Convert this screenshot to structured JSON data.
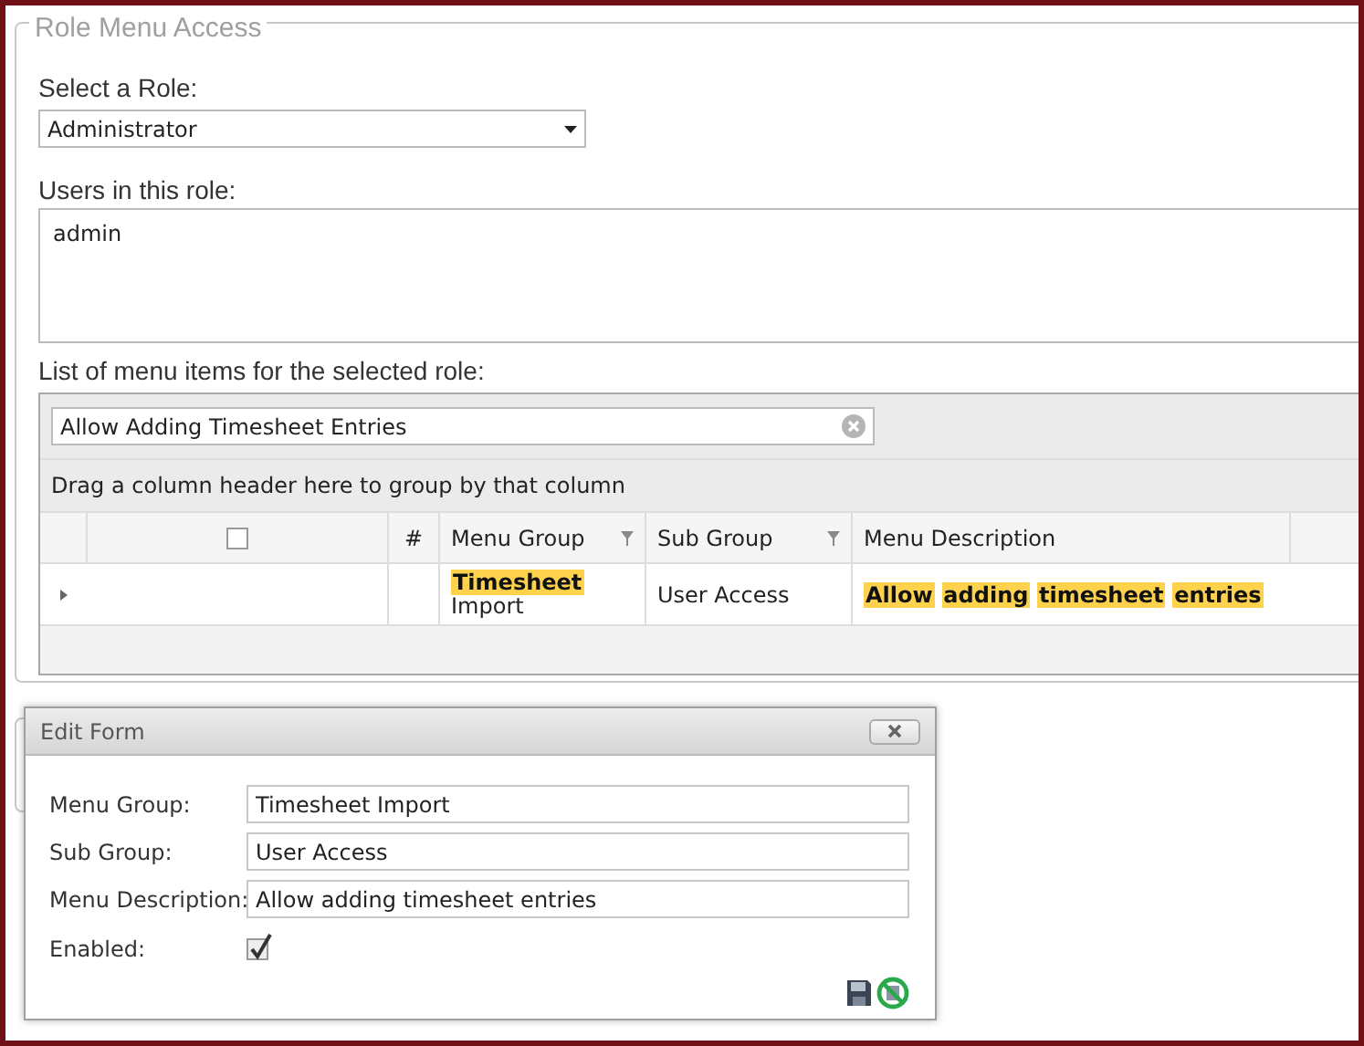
{
  "fieldset": {
    "legend": "Role Menu Access"
  },
  "role": {
    "label": "Select a Role:",
    "value": "Administrator"
  },
  "users": {
    "label": "Users in this role:",
    "items": [
      "admin"
    ]
  },
  "menu_items": {
    "label": "List of menu items for the selected role:",
    "search": {
      "value": "Allow Adding Timesheet Entries"
    },
    "group_panel": "Drag a column header here to group by that column",
    "select_all": {
      "checked": false
    },
    "columns": [
      {
        "label": "#",
        "filter": false
      },
      {
        "label": "Menu Group",
        "filter": true
      },
      {
        "label": "Sub Group",
        "filter": true
      },
      {
        "label": "Menu Description",
        "filter": false
      }
    ],
    "rows": [
      {
        "expanded": false,
        "menu_group": [
          {
            "text": "Timesheet",
            "highlighted": true
          },
          {
            "text": "Import",
            "highlighted": false
          }
        ],
        "sub_group": "User Access",
        "description": [
          {
            "text": "Allow",
            "highlighted": true
          },
          {
            "text": "adding",
            "highlighted": true
          },
          {
            "text": "timesheet",
            "highlighted": true
          },
          {
            "text": "entries",
            "highlighted": true
          }
        ]
      }
    ]
  },
  "edit_form": {
    "title": "Edit Form",
    "fields": [
      {
        "label": "Menu Group:",
        "value": "Timesheet Import"
      },
      {
        "label": "Sub Group:",
        "value": "User Access"
      },
      {
        "label": "Menu Description:",
        "value": "Allow adding timesheet entries"
      }
    ],
    "enabled": {
      "label": "Enabled:",
      "checked": true
    }
  }
}
